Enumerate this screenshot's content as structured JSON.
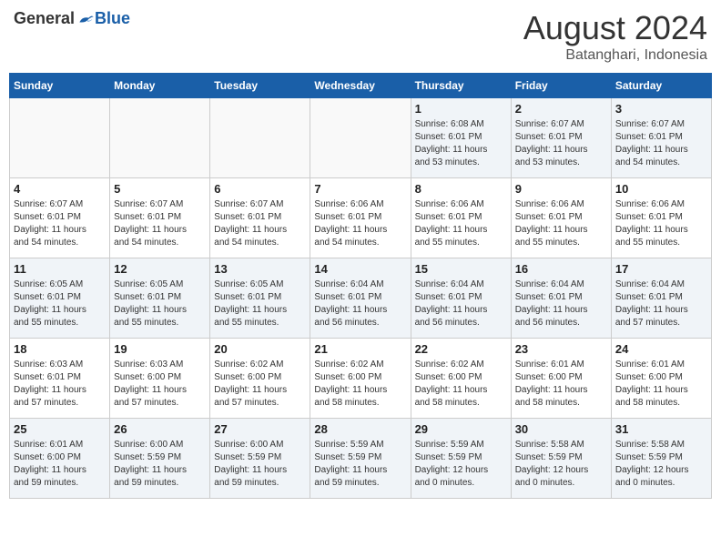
{
  "header": {
    "logo_general": "General",
    "logo_blue": "Blue",
    "month_year": "August 2024",
    "location": "Batanghari, Indonesia"
  },
  "days_of_week": [
    "Sunday",
    "Monday",
    "Tuesday",
    "Wednesday",
    "Thursday",
    "Friday",
    "Saturday"
  ],
  "weeks": [
    [
      {
        "day": "",
        "info": ""
      },
      {
        "day": "",
        "info": ""
      },
      {
        "day": "",
        "info": ""
      },
      {
        "day": "",
        "info": ""
      },
      {
        "day": "1",
        "info": "Sunrise: 6:08 AM\nSunset: 6:01 PM\nDaylight: 11 hours\nand 53 minutes."
      },
      {
        "day": "2",
        "info": "Sunrise: 6:07 AM\nSunset: 6:01 PM\nDaylight: 11 hours\nand 53 minutes."
      },
      {
        "day": "3",
        "info": "Sunrise: 6:07 AM\nSunset: 6:01 PM\nDaylight: 11 hours\nand 54 minutes."
      }
    ],
    [
      {
        "day": "4",
        "info": "Sunrise: 6:07 AM\nSunset: 6:01 PM\nDaylight: 11 hours\nand 54 minutes."
      },
      {
        "day": "5",
        "info": "Sunrise: 6:07 AM\nSunset: 6:01 PM\nDaylight: 11 hours\nand 54 minutes."
      },
      {
        "day": "6",
        "info": "Sunrise: 6:07 AM\nSunset: 6:01 PM\nDaylight: 11 hours\nand 54 minutes."
      },
      {
        "day": "7",
        "info": "Sunrise: 6:06 AM\nSunset: 6:01 PM\nDaylight: 11 hours\nand 54 minutes."
      },
      {
        "day": "8",
        "info": "Sunrise: 6:06 AM\nSunset: 6:01 PM\nDaylight: 11 hours\nand 55 minutes."
      },
      {
        "day": "9",
        "info": "Sunrise: 6:06 AM\nSunset: 6:01 PM\nDaylight: 11 hours\nand 55 minutes."
      },
      {
        "day": "10",
        "info": "Sunrise: 6:06 AM\nSunset: 6:01 PM\nDaylight: 11 hours\nand 55 minutes."
      }
    ],
    [
      {
        "day": "11",
        "info": "Sunrise: 6:05 AM\nSunset: 6:01 PM\nDaylight: 11 hours\nand 55 minutes."
      },
      {
        "day": "12",
        "info": "Sunrise: 6:05 AM\nSunset: 6:01 PM\nDaylight: 11 hours\nand 55 minutes."
      },
      {
        "day": "13",
        "info": "Sunrise: 6:05 AM\nSunset: 6:01 PM\nDaylight: 11 hours\nand 55 minutes."
      },
      {
        "day": "14",
        "info": "Sunrise: 6:04 AM\nSunset: 6:01 PM\nDaylight: 11 hours\nand 56 minutes."
      },
      {
        "day": "15",
        "info": "Sunrise: 6:04 AM\nSunset: 6:01 PM\nDaylight: 11 hours\nand 56 minutes."
      },
      {
        "day": "16",
        "info": "Sunrise: 6:04 AM\nSunset: 6:01 PM\nDaylight: 11 hours\nand 56 minutes."
      },
      {
        "day": "17",
        "info": "Sunrise: 6:04 AM\nSunset: 6:01 PM\nDaylight: 11 hours\nand 57 minutes."
      }
    ],
    [
      {
        "day": "18",
        "info": "Sunrise: 6:03 AM\nSunset: 6:01 PM\nDaylight: 11 hours\nand 57 minutes."
      },
      {
        "day": "19",
        "info": "Sunrise: 6:03 AM\nSunset: 6:00 PM\nDaylight: 11 hours\nand 57 minutes."
      },
      {
        "day": "20",
        "info": "Sunrise: 6:02 AM\nSunset: 6:00 PM\nDaylight: 11 hours\nand 57 minutes."
      },
      {
        "day": "21",
        "info": "Sunrise: 6:02 AM\nSunset: 6:00 PM\nDaylight: 11 hours\nand 58 minutes."
      },
      {
        "day": "22",
        "info": "Sunrise: 6:02 AM\nSunset: 6:00 PM\nDaylight: 11 hours\nand 58 minutes."
      },
      {
        "day": "23",
        "info": "Sunrise: 6:01 AM\nSunset: 6:00 PM\nDaylight: 11 hours\nand 58 minutes."
      },
      {
        "day": "24",
        "info": "Sunrise: 6:01 AM\nSunset: 6:00 PM\nDaylight: 11 hours\nand 58 minutes."
      }
    ],
    [
      {
        "day": "25",
        "info": "Sunrise: 6:01 AM\nSunset: 6:00 PM\nDaylight: 11 hours\nand 59 minutes."
      },
      {
        "day": "26",
        "info": "Sunrise: 6:00 AM\nSunset: 5:59 PM\nDaylight: 11 hours\nand 59 minutes."
      },
      {
        "day": "27",
        "info": "Sunrise: 6:00 AM\nSunset: 5:59 PM\nDaylight: 11 hours\nand 59 minutes."
      },
      {
        "day": "28",
        "info": "Sunrise: 5:59 AM\nSunset: 5:59 PM\nDaylight: 11 hours\nand 59 minutes."
      },
      {
        "day": "29",
        "info": "Sunrise: 5:59 AM\nSunset: 5:59 PM\nDaylight: 12 hours\nand 0 minutes."
      },
      {
        "day": "30",
        "info": "Sunrise: 5:58 AM\nSunset: 5:59 PM\nDaylight: 12 hours\nand 0 minutes."
      },
      {
        "day": "31",
        "info": "Sunrise: 5:58 AM\nSunset: 5:59 PM\nDaylight: 12 hours\nand 0 minutes."
      }
    ]
  ]
}
